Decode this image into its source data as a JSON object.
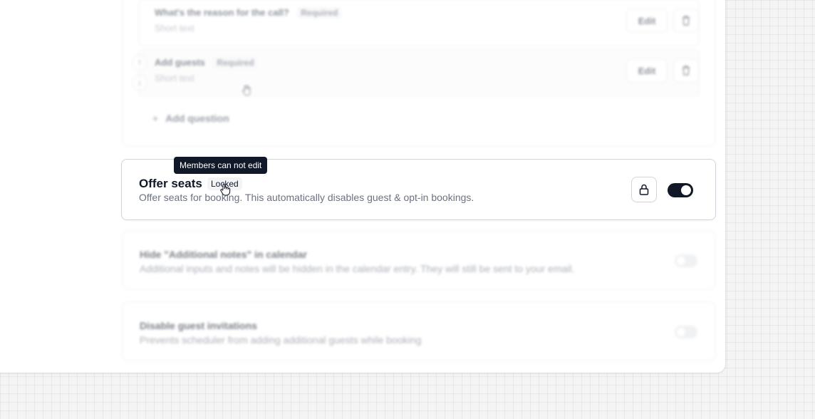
{
  "questions": [
    {
      "title": "What's the reason for the call?",
      "badge": "Required",
      "type": "Short text",
      "edit_label": "Edit"
    },
    {
      "title": "Add guests",
      "badge": "Required",
      "type": "Short text",
      "edit_label": "Edit"
    }
  ],
  "add_question": {
    "plus": "+",
    "label": "Add question"
  },
  "offer_seats": {
    "title": "Offer seats",
    "badge": "Locked",
    "description": "Offer seats for booking. This automatically disables guest & opt-in bookings.",
    "enabled": true
  },
  "tooltip": {
    "text": "Members can not edit"
  },
  "options": [
    {
      "title": "Hide \"Additional notes\" in calendar",
      "description": "Additional inputs and notes will be hidden in the calendar entry. They will still be sent to your email.",
      "enabled": false
    },
    {
      "title": "Disable guest invitations",
      "description": "Prevents scheduler from adding additional guests while booking",
      "enabled": false
    }
  ],
  "icons": {
    "trash": "trash-icon",
    "lock": "lock-icon",
    "arrow_up": "arrow-up-icon",
    "arrow_down": "arrow-down-icon",
    "cursor_hand": "hand-cursor-icon",
    "cursor_drag": "grab-cursor-icon"
  },
  "colors": {
    "toggle_on": "#111827",
    "toggle_off": "#e5e7eb",
    "tooltip_bg": "#111827",
    "badge_bg": "#f3f4f6"
  }
}
